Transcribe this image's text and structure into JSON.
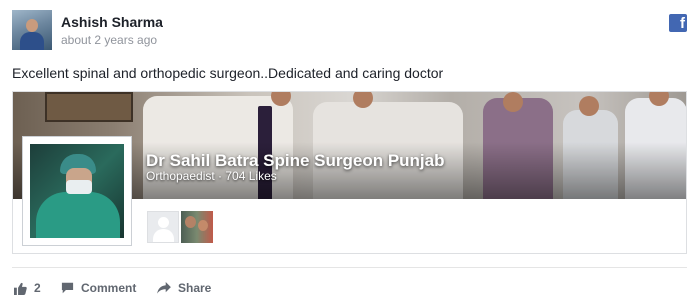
{
  "post": {
    "author": "Ashish Sharma",
    "timestamp": "about 2 years ago",
    "text": "Excellent spinal and orthopedic surgeon..Dedicated and caring doctor",
    "network_icon": "facebook-icon"
  },
  "page_card": {
    "title": "Dr Sahil Batra Spine Surgeon Punjab",
    "subtitle": "Orthopaedist · 704 Likes",
    "friends": [
      "default-avatar",
      "friend-photo"
    ]
  },
  "actions": {
    "like_count": "2",
    "comment_label": "Comment",
    "share_label": "Share"
  },
  "colors": {
    "facebook_blue": "#4267b2",
    "text_primary": "#1d2129",
    "text_secondary": "#90949c",
    "action_gray": "#616770"
  }
}
